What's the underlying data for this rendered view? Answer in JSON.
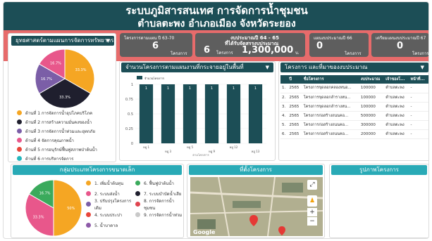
{
  "header": {
    "title": "ระบบภูมิสารสนเทศ การจัดการน้ำชุมชน",
    "subtitle": "ตำบลตะพง อำเภอเมือง จังหวัดระยอง"
  },
  "strategy_dropdown": {
    "label": "ยุทธศาสตร์ตามแผนการจัดการทรัพยากร..."
  },
  "kpis": [
    {
      "label": "โครงการตามแผน ปี 63-70",
      "value": "6",
      "unit": "โครงการ"
    },
    {
      "label": "งบประมาณปี 64 - 65",
      "label2": "ที่ได้รับจัดสรรงบประมาณ",
      "count": "6",
      "count_unit": "โครงการ",
      "amount": "1,300,000",
      "amount_unit": "บ."
    },
    {
      "label": "แผนงบประมาณปี 66",
      "value": "0",
      "unit": "โครงการ"
    },
    {
      "label": "เตรียมแผนงบประมาณปี 67",
      "value": "0",
      "unit": "โครงการ"
    }
  ],
  "pie1": {
    "slices": [
      {
        "label": "ด้านที่ 1 การจัดการน้ำอุปโภคบริโภค",
        "value": 33.3,
        "color": "#f5a623",
        "text": "33.3%"
      },
      {
        "label": "ด้านที่ 2 การสร้างความมั่นคงของน้ำ",
        "value": 33.3,
        "color": "#1f1f2e",
        "text": "33.3%"
      },
      {
        "label": "ด้านที่ 3 การจัดการน้ำท่วมและอุทกภัย",
        "value": 16.7,
        "color": "#7b5ea7",
        "text": "16.7%"
      },
      {
        "label": "ด้านที่ 4 จัดการคุณภาพน้ำ",
        "value": 16.7,
        "color": "#e8578b",
        "text": "16.7%"
      },
      {
        "label": "ด้านที่ 5 การอนุรักษ์ฟื้นฟูสภาพป่าต้นน้ำ",
        "value": 0,
        "color": "#e8463a",
        "text": ""
      },
      {
        "label": "ด้านที่ 6 การบริหารจัดการ",
        "value": 0,
        "color": "#26b7bc",
        "text": ""
      }
    ]
  },
  "bar_panel": {
    "title": "จำนวนโครงการตามแผนงานที่กระจายอยู่ในพื้นที่"
  },
  "chart_data": {
    "type": "bar",
    "categories": [
      "หมู่ 1",
      "หมู่ 3",
      "หมู่ 5",
      "หมู่ 9",
      "หมู่ 12",
      "หมู่ 13"
    ],
    "series": [
      {
        "name": "จำนวนโครงการ",
        "values": [
          1,
          1,
          1,
          1,
          1,
          1
        ]
      }
    ],
    "yticks": [
      "1",
      "0.75",
      "0.5",
      "0.25",
      "0"
    ],
    "xlabel": "ตามโครงการ",
    "ylim": [
      0,
      1
    ],
    "color": "#1c4e56"
  },
  "table_panel": {
    "title": "โครงการ และที่มาของงบประมาณ",
    "columns": [
      "",
      "ปี",
      "ชื่อโครงการ",
      "งบประมาณ",
      "เจ้าของโ...",
      "หน้าที่..."
    ],
    "rows": [
      [
        "1.",
        "2565",
        "โครงการขุดลอกคลองหนอ...",
        "100000",
        "ตำบลตะพง",
        "-"
      ],
      [
        "2.",
        "2565",
        "โครงการขุดลอกลำรางหน...",
        "100000",
        "ตำบลตะพง",
        "-"
      ],
      [
        "3.",
        "2565",
        "โครงการขุดลอกลำรางหน...",
        "100000",
        "ตำบลตะพง",
        "-"
      ],
      [
        "4.",
        "2565",
        "โครงการก่อสร้างถนนคอ...",
        "500000",
        "ตำบลตะพง",
        "-"
      ],
      [
        "5.",
        "2565",
        "โครงการก่อสร้างถนนคอ...",
        "300000",
        "ตำบลตะพง",
        "-"
      ],
      [
        "6.",
        "2565",
        "โครงการก่อสร้างถนนคอ...",
        "200000",
        "ตำบลตะพง",
        "-"
      ]
    ]
  },
  "pie2": {
    "title": "กลุ่มประเภทโครงการขนาดเล็ก",
    "slices": [
      {
        "label": "1. เพิ่มน้ำต้นทุน",
        "value": 50,
        "color": "#f5a623",
        "text": "50%"
      },
      {
        "label": "2. ระบบส่งน้ำ",
        "value": 33.3,
        "color": "#e8578b",
        "text": "33.3%"
      },
      {
        "label": "3. ปรับปรุงโครงการเดิม",
        "value": 0,
        "color": "#7b5ea7",
        "text": ""
      },
      {
        "label": "4. ระบบประปา",
        "value": 0,
        "color": "#e8463a",
        "text": ""
      },
      {
        "label": "5. น้ำบาดาล",
        "value": 0,
        "color": "#8d5aa8",
        "text": ""
      },
      {
        "label": "6. ฟื้นฟูป่าต้นน้ำ",
        "value": 16.7,
        "color": "#3aaa5c",
        "text": "16.7%"
      },
      {
        "label": "7. ระบบบำบัดน้ำเสีย",
        "value": 0,
        "color": "#1f1f2e",
        "text": ""
      },
      {
        "label": "8. การจัดการน้ำชุมชน",
        "value": 0,
        "color": "#e0454f",
        "text": ""
      },
      {
        "label": "9. การจัดการน้ำท่วม",
        "value": 0,
        "color": "#c9c9c9",
        "text": ""
      }
    ]
  },
  "map_panel": {
    "title": "ที่ตั้งโครงการ",
    "google": "Google"
  },
  "photo_panel": {
    "title": "รูปภาพโครงการ"
  }
}
